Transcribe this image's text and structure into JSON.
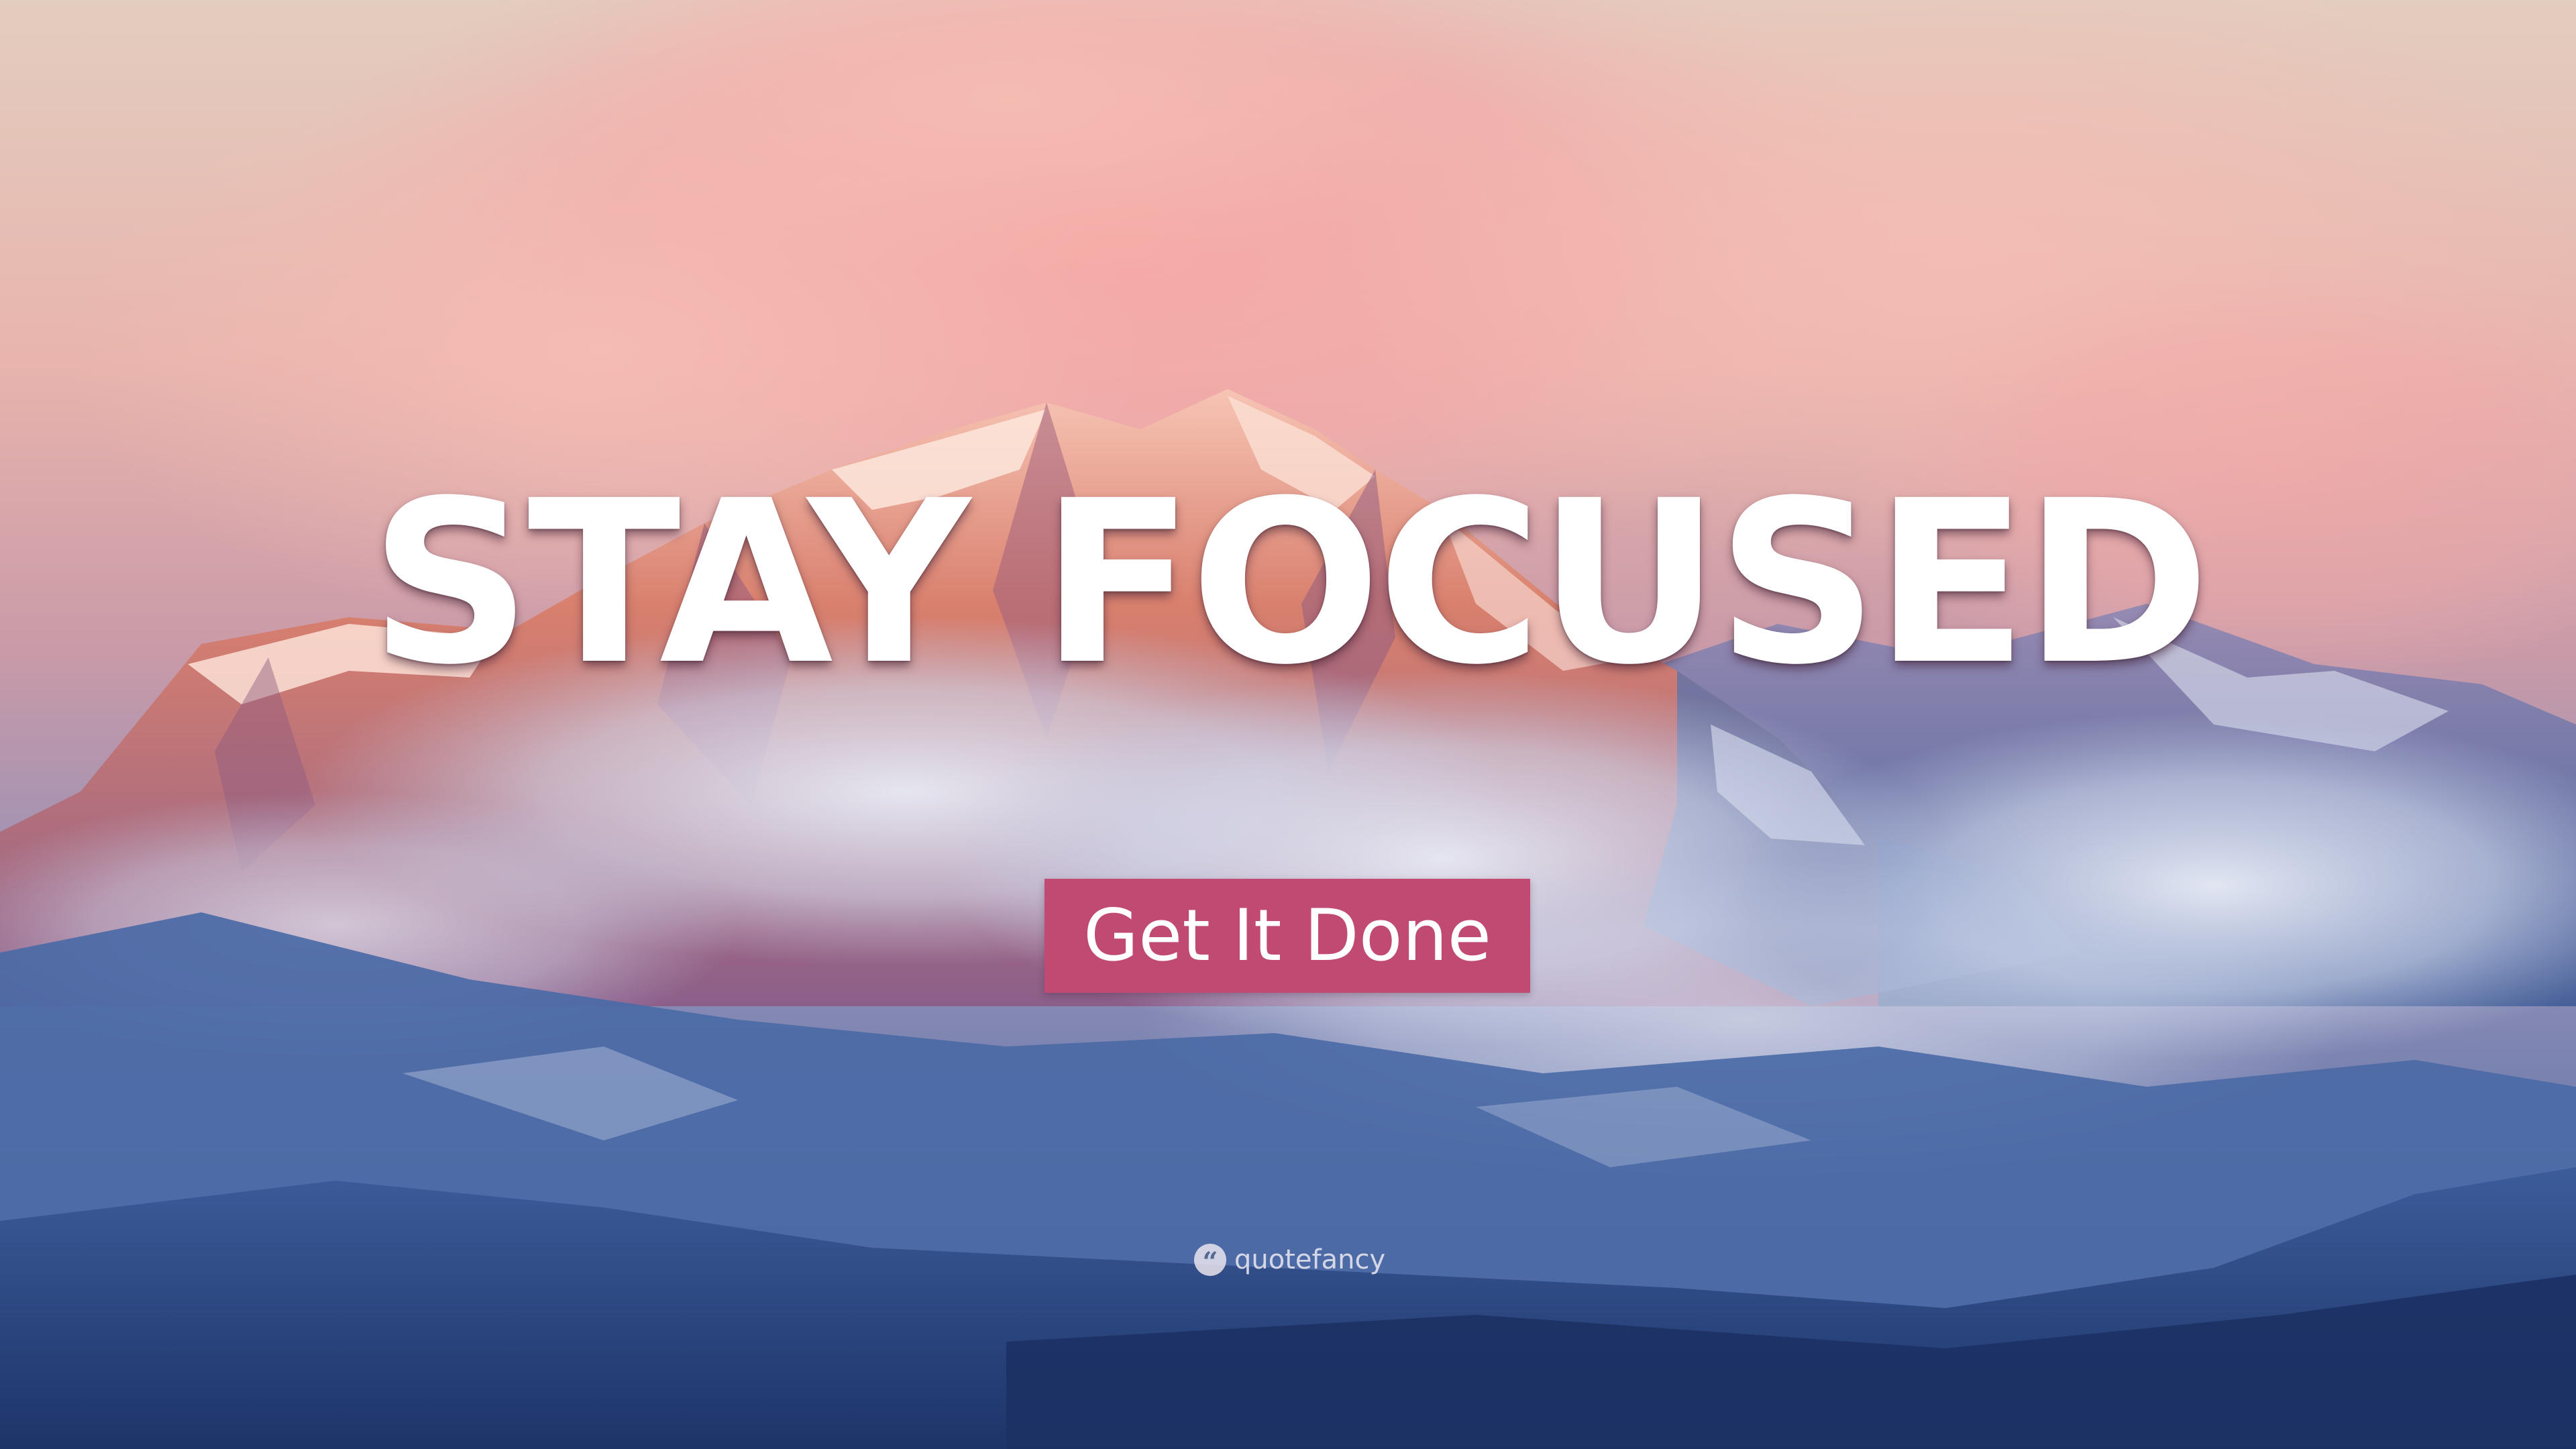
{
  "quote": {
    "text": "STAY FOCUSED"
  },
  "author": {
    "label": "Get It Done",
    "background_color": "#c04a72"
  },
  "brand": {
    "icon": "quote-marks-icon",
    "icon_glyph": "“",
    "name": "quotefancy"
  },
  "palette": {
    "sky_top": "#d8c4bc",
    "cloud_pink": "#f2a6a8",
    "mountain_sunlit": "#d87866",
    "mountain_shadow": "#4a6aa4",
    "valley_haze": "#c8d0e8",
    "foreground_dark": "#213c70"
  }
}
